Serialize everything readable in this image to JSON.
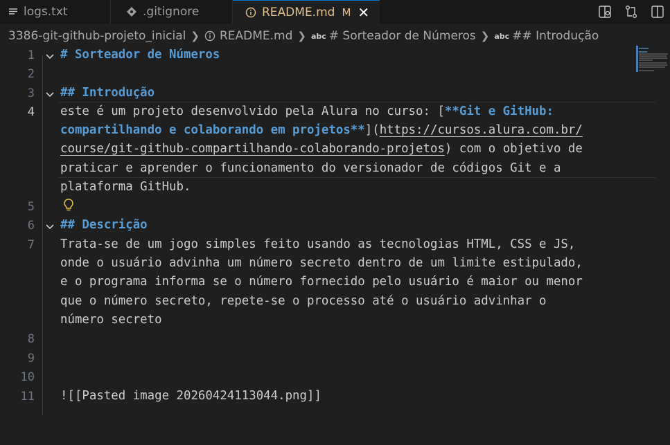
{
  "tabs": [
    {
      "label": "logs.txt",
      "icon": "list-lines-icon",
      "active": false
    },
    {
      "label": ".gitignore",
      "icon": "git-diamond-icon",
      "active": false
    },
    {
      "label": "README.md",
      "icon": "info-icon",
      "active": true,
      "badge": "M",
      "close": "✕"
    }
  ],
  "actions": [
    "open-preview-icon",
    "compare-changes-icon",
    "split-editor-icon"
  ],
  "breadcrumb": {
    "folder": "3386-git-github-projeto_inicial",
    "file": "README.md",
    "section1_prefix": "abc",
    "section1": "# Sorteador de Números",
    "section2_prefix": "abc",
    "section2": "## Introdução"
  },
  "editor": {
    "line_numbers": [
      "1",
      "2",
      "3",
      "4",
      "5",
      "6",
      "7",
      "8",
      "9",
      "10",
      "11"
    ],
    "current_line": "4",
    "lines": {
      "l1": "# Sorteador de Números",
      "l3": "## Introdução",
      "l4a_text": "este é um projeto desenvolvido pela Alura no curso: [",
      "l4a_bold": "**Git e GitHub:",
      "l4b_bold": "compartilhando e colaborando em projetos**",
      "l4b_bracket": "](",
      "l4b_url": "https://cursos.alura.com.br/",
      "l4c_url": "course/git-github-compartilhando-colaborando-projetos",
      "l4c_close": ")",
      "l4c_text": " com o objetivo de",
      "l4d": "praticar e aprender o funcionamento do versionador de códigos Git e a",
      "l4e": "plataforma GitHub.",
      "l6": "## Descrição",
      "l7a": "Trata-se de um jogo simples feito usando as tecnologias HTML, CSS e JS,",
      "l7b": "onde o usuário advinha um número secreto dentro de um limite estipulado,",
      "l7c": "e o programa informa se o número fornecido pelo usuário é maior ou menor",
      "l7d": "que o número secreto, repete-se o processo até o usuário advinhar o",
      "l7e": "número secreto",
      "l11": "![[Pasted image 20260424113044.png]]"
    }
  },
  "colors": {
    "background": "#1f1f1f",
    "tabbar": "#181818",
    "heading": "#569cd6",
    "modified": "#e2c08d",
    "accent": "#0078d4"
  }
}
